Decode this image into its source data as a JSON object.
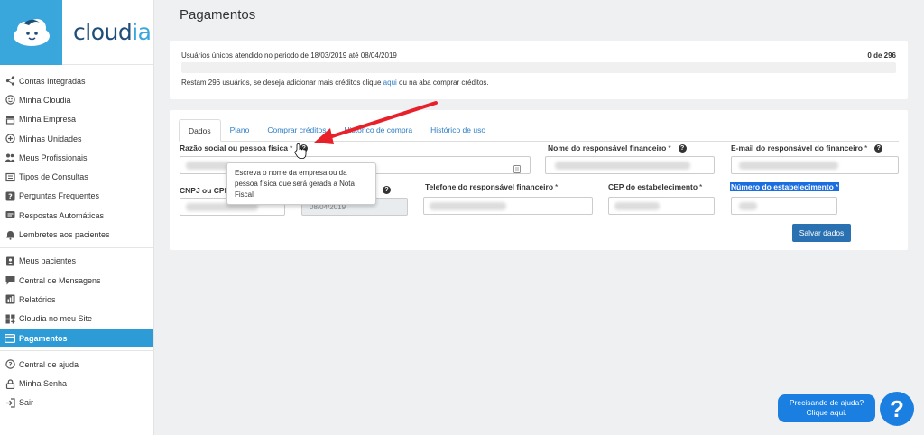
{
  "brand": {
    "name_main": "cloud",
    "name_accent": "ia"
  },
  "sidebar": {
    "group1": [
      {
        "label": "Contas Integradas",
        "icon": "share-icon"
      },
      {
        "label": "Minha Cloudia",
        "icon": "smiley-icon"
      },
      {
        "label": "Minha Empresa",
        "icon": "store-icon"
      },
      {
        "label": "Minhas Unidades",
        "icon": "plus-circle-icon"
      },
      {
        "label": "Meus Profissionais",
        "icon": "users-icon"
      },
      {
        "label": "Tipos de Consultas",
        "icon": "list-icon"
      },
      {
        "label": "Perguntas Frequentes",
        "icon": "question-square-icon"
      },
      {
        "label": "Respostas Automáticas",
        "icon": "message-icon"
      },
      {
        "label": "Lembretes aos pacientes",
        "icon": "bell-icon"
      }
    ],
    "group2": [
      {
        "label": "Meus pacientes",
        "icon": "contact-icon"
      },
      {
        "label": "Central de Mensagens",
        "icon": "chat-icon"
      },
      {
        "label": "Relatórios",
        "icon": "chart-icon"
      },
      {
        "label": "Cloudia no meu Site",
        "icon": "grid-plus-icon"
      },
      {
        "label": "Pagamentos",
        "icon": "credit-card-icon"
      }
    ],
    "group3": [
      {
        "label": "Central de ajuda",
        "icon": "help-circle-icon"
      },
      {
        "label": "Minha Senha",
        "icon": "lock-icon"
      },
      {
        "label": "Sair",
        "icon": "logout-icon"
      }
    ],
    "active": "Pagamentos"
  },
  "page": {
    "title": "Pagamentos"
  },
  "usage": {
    "period_text": "Usuários únicos atendido no periodo de 18/03/2019 até 08/04/2019",
    "count": "0 de 296",
    "progress": 0,
    "remain_before": "Restam 296 usuários, se deseja adicionar mais créditos clique ",
    "remain_link": "aqui",
    "remain_after": " ou na aba comprar créditos."
  },
  "tabs": [
    "Dados",
    "Plano",
    "Comprar créditos",
    "Histórico de compra",
    "Histórico de uso"
  ],
  "form": {
    "razao_label": "Razão social ou pessoa física",
    "nome_resp_label": "Nome do responsável financeiro",
    "email_resp_label": "E-mail do responsável do financeiro",
    "cnpj_label": "CNPJ ou CPF",
    "telefone_label": "Telefone do responsável financeiro",
    "cep_label": "CEP do estabelecimento",
    "numero_label": "Número do estabelecimento",
    "date_value": "08/04/2019",
    "required_mark": "*",
    "save_label": "Salvar dados"
  },
  "tooltip": {
    "text": "Escreva o nome da empresa ou da pessoa física que será gerada a Nota Fiscal"
  },
  "help": {
    "line1": "Precisando de ajuda?",
    "line2": "Clique aqui.",
    "icon_glyph": "?"
  },
  "colors": {
    "accent": "#3aa7dc",
    "active_nav": "#2d9cd6",
    "button": "#2a71b2",
    "help": "#1a7fe0",
    "annotation_arrow": "#e8202a"
  }
}
